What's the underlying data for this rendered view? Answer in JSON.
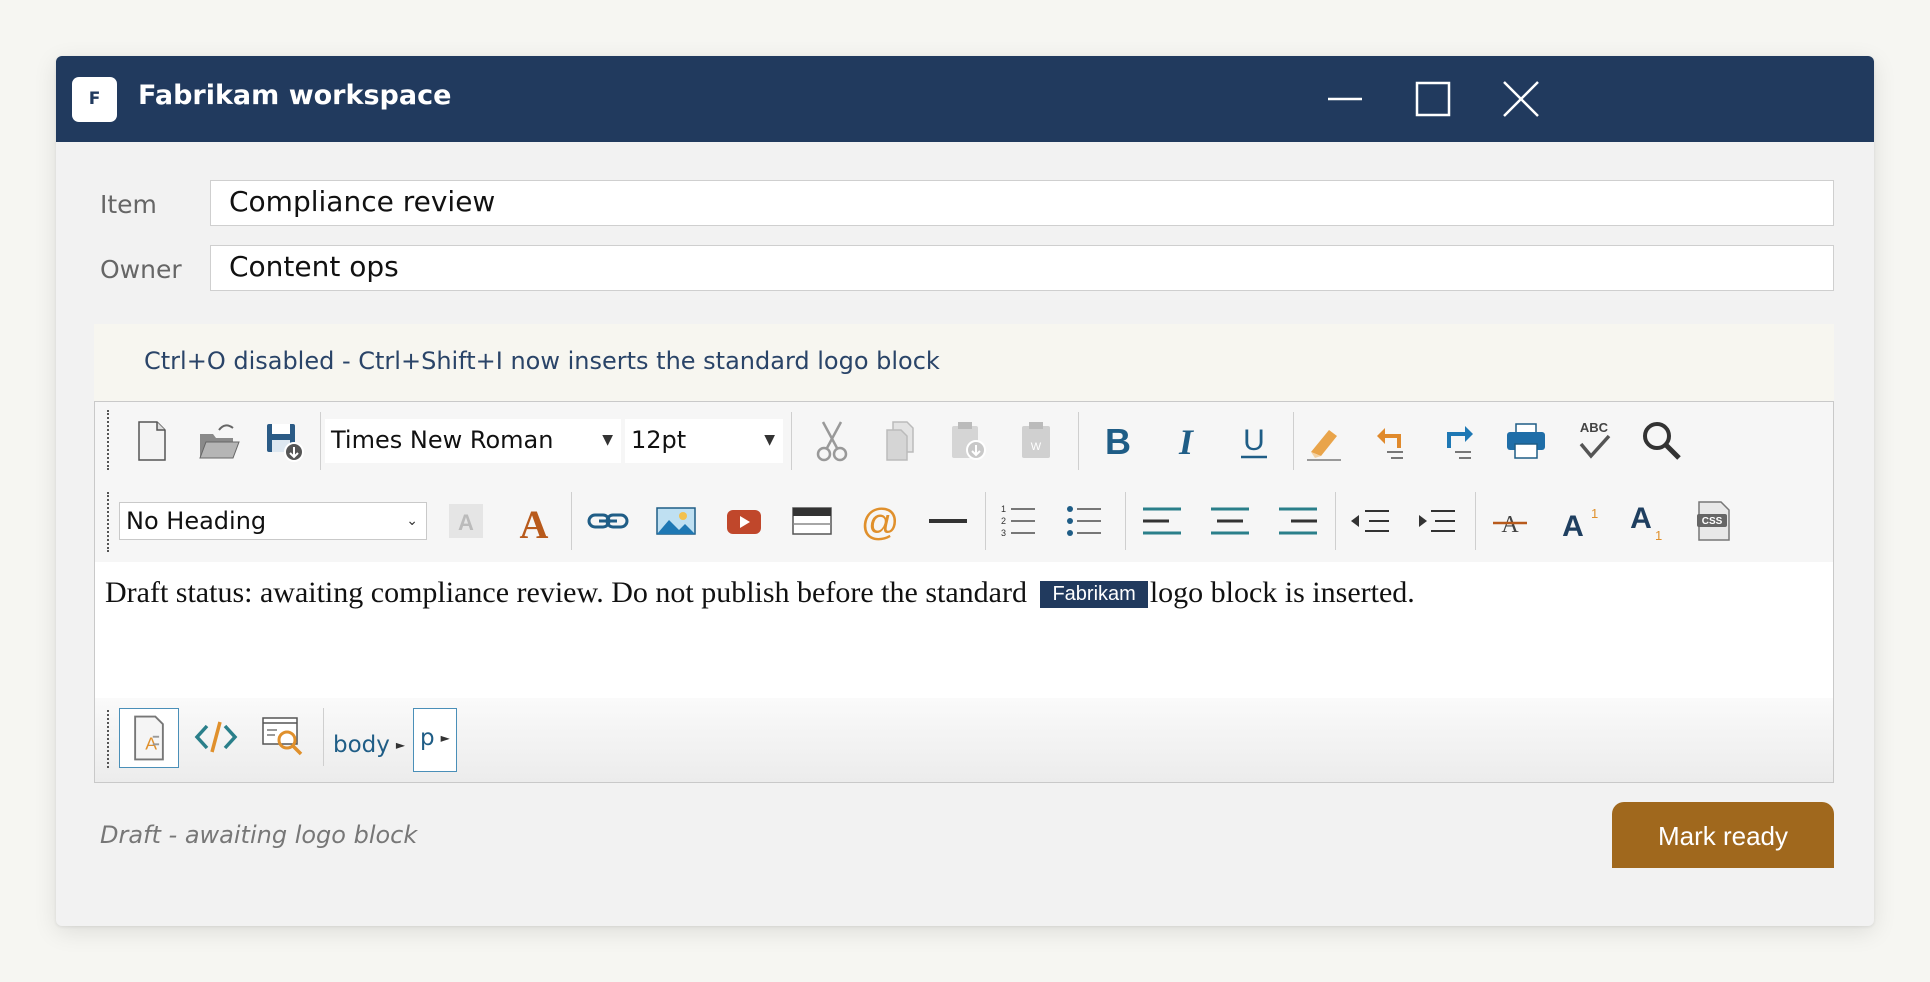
{
  "window": {
    "title": "Fabrikam workspace",
    "app_icon_letter": "F"
  },
  "fields": {
    "item_label": "Item",
    "item_value": "Compliance review",
    "owner_label": "Owner",
    "owner_value": "Content ops"
  },
  "hint": "Ctrl+O disabled - Ctrl+Shift+I now inserts the standard logo block",
  "toolbar": {
    "font_family": "Times New Roman",
    "font_size": "12pt",
    "heading": "No Heading",
    "icons_row1": [
      "new-document",
      "open",
      "save",
      "cut",
      "copy",
      "paste-special",
      "paste-word",
      "bold",
      "italic",
      "underline",
      "clear-format",
      "undo",
      "redo",
      "print",
      "spell-check",
      "find"
    ],
    "icons_row2": [
      "highlight-color",
      "font-color",
      "link",
      "image",
      "video",
      "table",
      "email-link",
      "horizontal-rule",
      "ordered-list",
      "unordered-list",
      "align-left",
      "align-center",
      "align-right",
      "outdent",
      "indent",
      "strikethrough",
      "superscript",
      "subscript",
      "css"
    ]
  },
  "content": {
    "before": "Draft status: awaiting compliance review. Do not publish before the standard",
    "logo_chip": "Fabrikam",
    "after": "logo block is inserted."
  },
  "statusbar": {
    "crumb_body": "body",
    "crumb_p": "p"
  },
  "footer": {
    "status": "Draft - awaiting logo block",
    "ready_button": "Mark ready"
  },
  "colors": {
    "titlebar": "#213a5e",
    "accent": "#a0681d",
    "link": "#1f5d86"
  }
}
